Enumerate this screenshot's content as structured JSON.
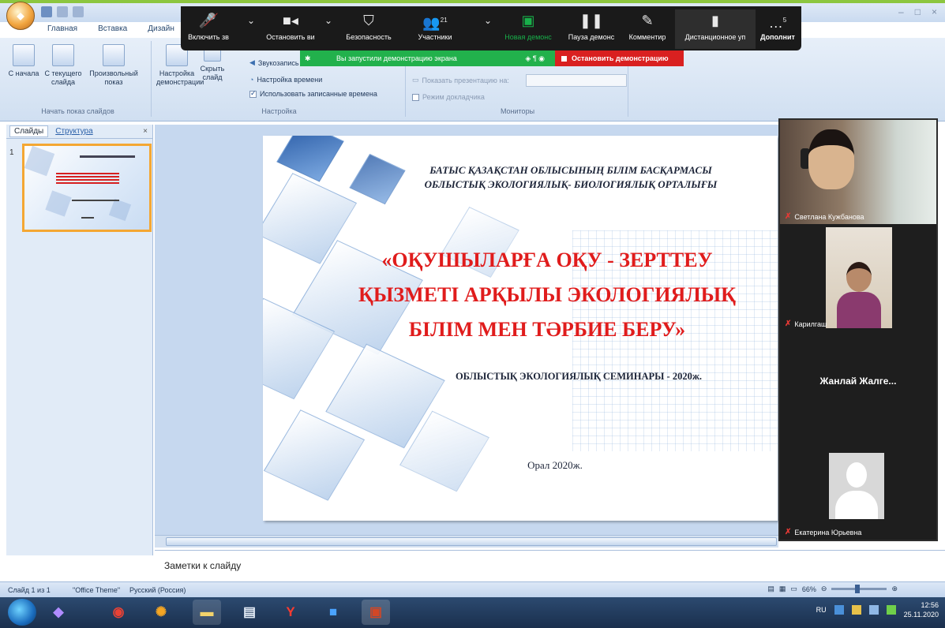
{
  "window": {
    "title_controls": [
      "–",
      "□",
      "×"
    ]
  },
  "tabs": [
    "Главная",
    "Вставка",
    "Дизайн"
  ],
  "ribbon": {
    "group_start": {
      "label": "Начать показ слайдов",
      "buttons": [
        "С начала",
        "С текущего слайда",
        "Произвольный показ"
      ]
    },
    "group_settings": {
      "label": "Настройка",
      "buttons": [
        "Настройка демонстрации",
        "Скрыть слайд"
      ],
      "lines": [
        "Звукозапись",
        "Настройка времени",
        "Использовать записанные времена"
      ]
    },
    "group_monitors": {
      "label": "Мониторы",
      "lines": [
        "Показать презентацию на:",
        "Режим докладчика"
      ]
    }
  },
  "zoom_toolbar": {
    "items": [
      {
        "label": "Включить зв",
        "icon": "mic-muted-icon"
      },
      {
        "label": "Остановить ви",
        "icon": "video-icon"
      },
      {
        "label": "Безопасность",
        "icon": "shield-icon"
      },
      {
        "label": "Участники",
        "icon": "participants-icon",
        "count": "21"
      },
      {
        "label": "Новая демонс",
        "icon": "share-icon"
      },
      {
        "label": "Пауза демонс",
        "icon": "pause-icon"
      },
      {
        "label": "Комментир",
        "icon": "pen-icon"
      },
      {
        "label": "Дистанционное уп",
        "icon": "mouse-icon"
      },
      {
        "label": "Дополнит",
        "icon": "more-icon",
        "count": "5"
      }
    ],
    "share_message": "Вы запустили демонстрацию экрана",
    "stop_share": "Остановить демонстрацию"
  },
  "left_pane": {
    "tab_slides": "Слайды",
    "tab_outline": "Структура",
    "close": "×",
    "slide_number": "1"
  },
  "slide": {
    "header_line1": "БАТЫС ҚАЗАҚСТАН ОБЛЫСЫНЫҢ БІЛІМ БАСҚАРМАСЫ",
    "header_line2": "ОБЛЫСТЫҚ ЭКОЛОГИЯЛЫҚ- БИОЛОГИЯЛЫҚ ОРТАЛЫҒЫ",
    "title_line1": "«ОҚУШЫЛАРҒА ОҚУ - ЗЕРТТЕУ",
    "title_line2": "ҚЫЗМЕТІ АРҚЫЛЫ  ЭКОЛОГИЯЛЫҚ",
    "title_line3": "БІЛІМ МЕН ТӘРБИЕ БЕРУ»",
    "seminar": "ОБЛЫСТЫҚ ЭКОЛОГИЯЛЫҚ СЕМИНАРЫ - 2020ж.",
    "city": "Орал 2020ж."
  },
  "notes": {
    "placeholder": "Заметки к слайду"
  },
  "status": {
    "slide": "Слайд 1 из 1",
    "theme": "\"Office Theme\"",
    "language": "Русский (Россия)",
    "zoom": "66%"
  },
  "participants": [
    {
      "name": "Светлана Кужбанова",
      "video": true
    },
    {
      "name": "Карилгаш",
      "video": true
    },
    {
      "name": "Жанлай  Жалге...",
      "video": false
    },
    {
      "name": "Екатерина Юрьевна",
      "video": false
    }
  ],
  "taskbar": {
    "lang": "RU",
    "time": "12:56",
    "date": "25.11.2020"
  }
}
